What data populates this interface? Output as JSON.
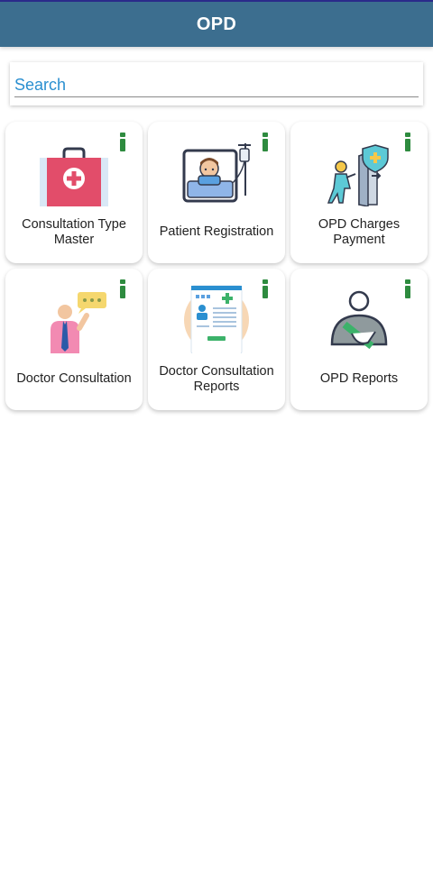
{
  "header": {
    "title": "OPD"
  },
  "search": {
    "placeholder": "Search"
  },
  "tiles": [
    {
      "label": "Consultation Type Master",
      "icon": "first-aid-kit-icon"
    },
    {
      "label": "Patient Registration",
      "icon": "patient-bed-icon"
    },
    {
      "label": "OPD Charges Payment",
      "icon": "insurance-exit-icon"
    },
    {
      "label": "Doctor Consultation",
      "icon": "doctor-speech-icon"
    },
    {
      "label": "Doctor Consultation Reports",
      "icon": "medical-report-icon"
    },
    {
      "label": "OPD Reports",
      "icon": "injured-person-icon"
    }
  ],
  "colors": {
    "appbar": "#3c6e8f",
    "accent": "#2a8fd0",
    "info": "#2e8b3f"
  }
}
